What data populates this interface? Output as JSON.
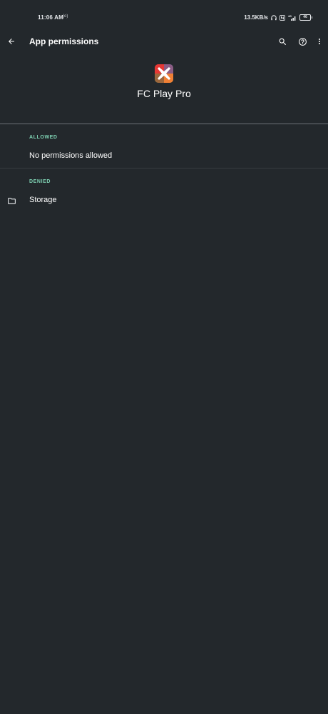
{
  "status_bar": {
    "time": "11:06 AM",
    "sync_indicator": "(o)",
    "network_speed": "13.5KB/s",
    "battery_level": "46",
    "icons": [
      "headset-icon",
      "nfc-icon",
      "signal-icon",
      "battery-icon"
    ]
  },
  "toolbar": {
    "title": "App permissions",
    "icons": [
      "back-arrow-icon",
      "search-icon",
      "help-icon",
      "more-vert-icon"
    ]
  },
  "app": {
    "name": "FC Play Pro",
    "icon": "app-logo-icon",
    "icon_colors": [
      "#e53935",
      "#1e88e5",
      "#fdd835",
      "#43a047",
      "#ffffff"
    ]
  },
  "sections": {
    "allowed": {
      "header": "ALLOWED",
      "items": [
        {
          "label": "No permissions allowed"
        }
      ]
    },
    "denied": {
      "header": "DENIED",
      "items": [
        {
          "label": "Storage",
          "icon": "folder-icon"
        }
      ]
    }
  },
  "colors": {
    "background": "#23282c",
    "accent": "#7fd3b4",
    "text": "#ffffff"
  }
}
